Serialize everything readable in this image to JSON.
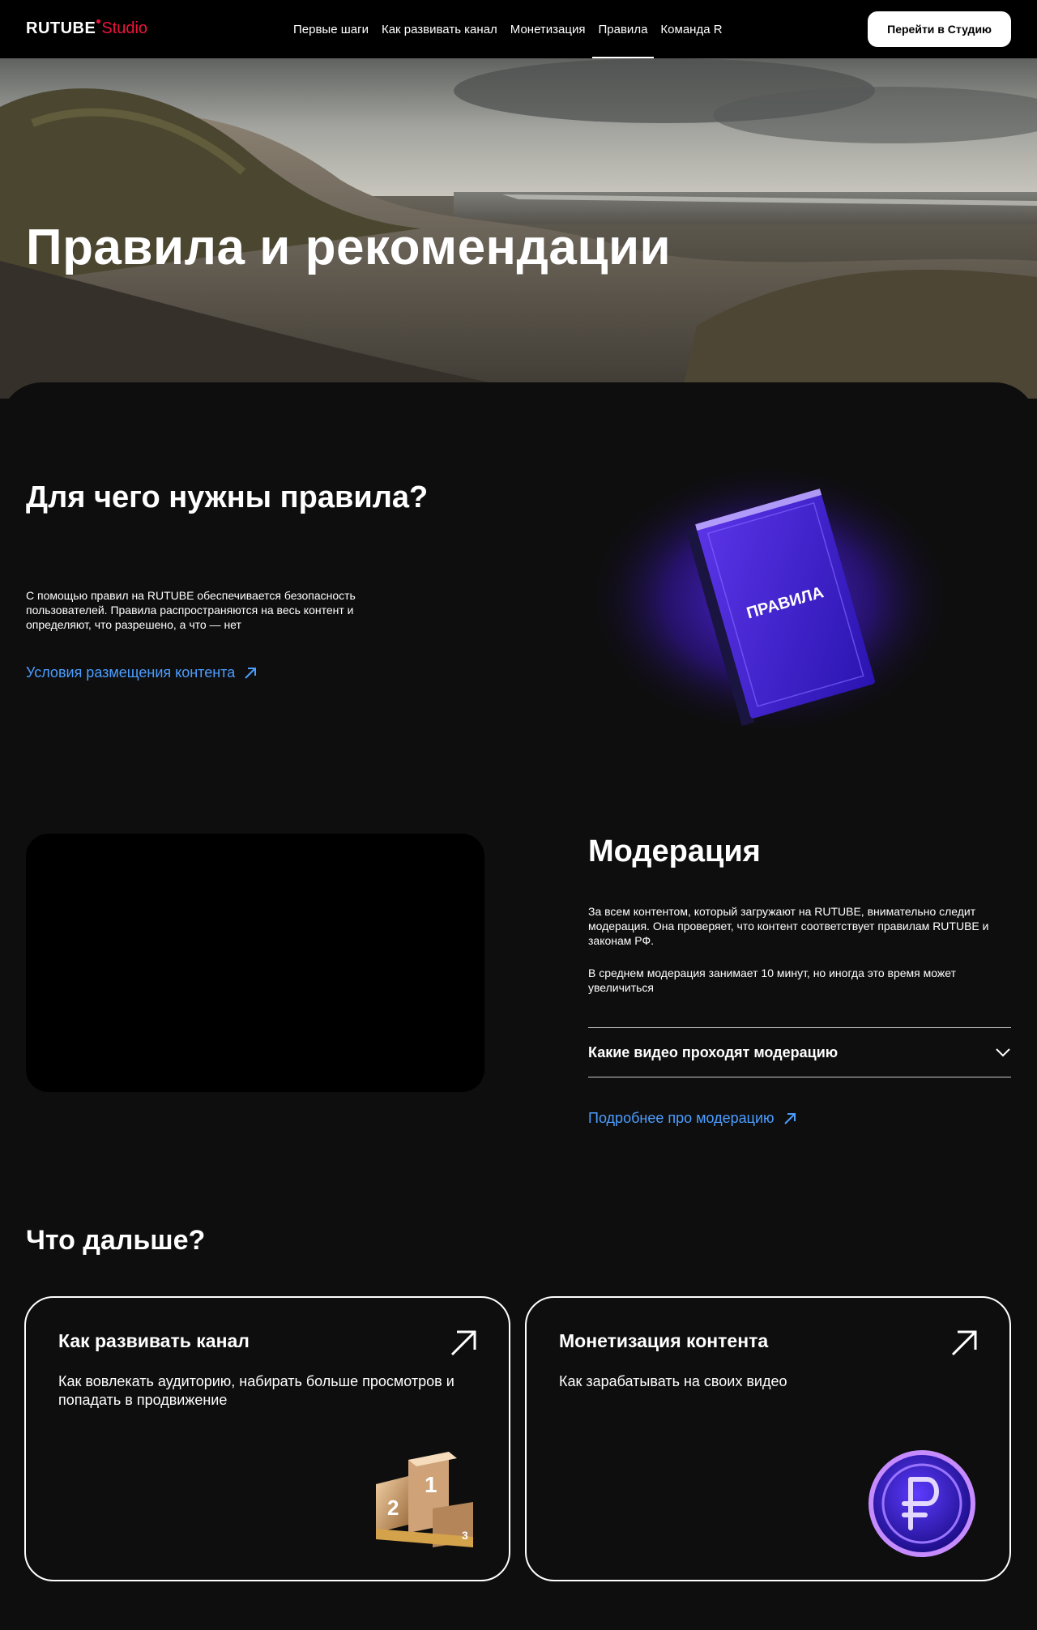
{
  "header": {
    "logo_main": "RUTUBE",
    "logo_studio": "Studio",
    "nav": [
      {
        "label": "Первые шаги",
        "active": false
      },
      {
        "label": "Как развивать канал",
        "active": false
      },
      {
        "label": "Монетизация",
        "active": false
      },
      {
        "label": "Правила",
        "active": true
      },
      {
        "label": "Команда R",
        "active": false
      }
    ],
    "studio_button": "Перейти в Студию"
  },
  "hero": {
    "title": "Правила и рекомендации"
  },
  "rules": {
    "title": "Для чего нужны правила?",
    "text": "С помощью правил на RUTUBE обеспечивается безопасность пользователей. Правила распространяются на весь контент и определяют, что разрешено, а что — нет",
    "link": "Условия размещения контента",
    "book_label": "ПРАВИЛА",
    "book_color": "#3a1fd6"
  },
  "moderation": {
    "title": "Модерация",
    "text1": "За всем контентом, который загружают на RUTUBE, внимательно следит модерация. Она проверяет, что контент соответствует правилам RUTUBE и законам РФ.",
    "text2": "В среднем модерация занимает 10 минут, но иногда это время может увеличиться",
    "accordion": "Какие видео проходят модерацию",
    "link": "Подробнее про модерацию"
  },
  "next": {
    "title": "Что дальше?",
    "cards": [
      {
        "title": "Как развивать канал",
        "desc": "Как вовлекать аудиторию, набирать больше просмотров и попадать в продвижение",
        "icon": "podium-icon"
      },
      {
        "title": "Монетизация контента",
        "desc": "Как зарабатывать на своих видео",
        "icon": "ruble-coin-icon"
      }
    ]
  },
  "colors": {
    "accent_red": "#ed143b",
    "link_blue": "#4c9dff",
    "background": "#0e0e0e"
  }
}
